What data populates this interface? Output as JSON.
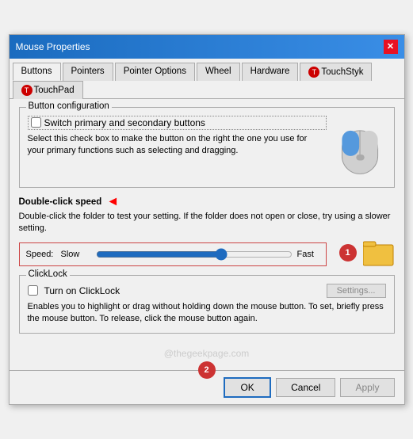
{
  "window": {
    "title": "Mouse Properties",
    "close_label": "✕"
  },
  "tabs": [
    {
      "label": "Buttons",
      "active": true
    },
    {
      "label": "Pointers",
      "active": false
    },
    {
      "label": "Pointer Options",
      "active": false
    },
    {
      "label": "Wheel",
      "active": false
    },
    {
      "label": "Hardware",
      "active": false
    },
    {
      "label": "TouchStyk",
      "active": false,
      "has_icon": true
    },
    {
      "label": "TouchPad",
      "active": false,
      "has_icon": true
    }
  ],
  "button_config": {
    "group_label": "Button configuration",
    "checkbox_label": "Switch primary and secondary buttons",
    "description": "Select this check box to make the button on the right the one you use for your primary functions such as selecting and dragging."
  },
  "double_click": {
    "section_label": "Double-click speed",
    "description": "Double-click the folder to test your setting. If the folder does not open or close, try using a slower setting.",
    "speed_label": "Speed:",
    "slow_label": "Slow",
    "fast_label": "Fast",
    "slider_value": 65,
    "badge": "1"
  },
  "clicklock": {
    "group_label": "ClickLock",
    "checkbox_label": "Turn on ClickLock",
    "settings_label": "Settings...",
    "description": "Enables you to highlight or drag without holding down the mouse button. To set, briefly press the mouse button. To release, click the mouse button again."
  },
  "watermark": "@thegeekpage.com",
  "footer": {
    "ok_label": "OK",
    "cancel_label": "Cancel",
    "apply_label": "Apply",
    "badge": "2"
  }
}
